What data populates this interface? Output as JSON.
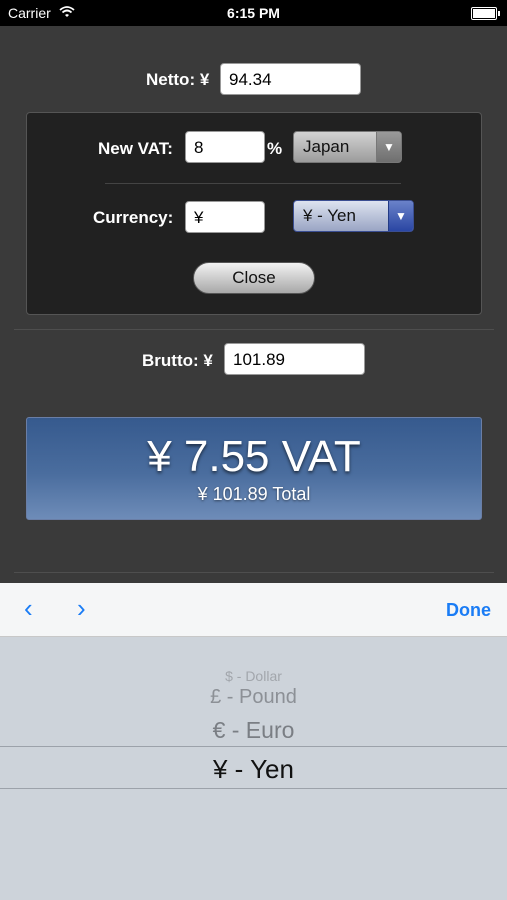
{
  "status_bar": {
    "carrier": "Carrier",
    "time": "6:15 PM"
  },
  "netto": {
    "label": "Netto: ¥",
    "value": "94.34"
  },
  "settings": {
    "vat_label": "New VAT:",
    "vat_value": "8",
    "percent": "%",
    "country": "Japan",
    "currency_label": "Currency:",
    "currency_symbol": "¥",
    "currency_select": "¥ - Yen",
    "close_label": "Close"
  },
  "brutto": {
    "label": "Brutto: ¥",
    "value": "101.89"
  },
  "result": {
    "vat_text": "¥ 7.55 VAT",
    "total_text": "¥ 101.89 Total"
  },
  "toolbar": {
    "prev": "‹",
    "next": "›",
    "done": "Done"
  },
  "picker": {
    "options": [
      "",
      "$ - Dollar",
      "£ - Pound",
      "€ - Euro"
    ],
    "selected": "¥ - Yen"
  },
  "colors": {
    "accent": "#1a7cf5",
    "result_panel": "#365a8e",
    "background": "#3a3a3a"
  }
}
